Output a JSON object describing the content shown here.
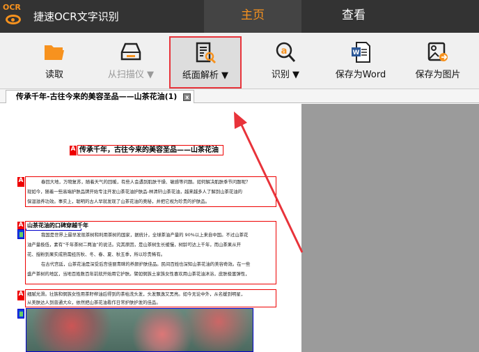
{
  "app": {
    "logo_text": "OCR",
    "title": "捷速OCR文字识别"
  },
  "tabs": [
    {
      "label": "主页",
      "active": true
    },
    {
      "label": "查看",
      "active": false
    }
  ],
  "toolbar": {
    "items": [
      {
        "label": "读取",
        "icon": "folder-icon"
      },
      {
        "label": "从扫描仪 ▼",
        "icon": "scanner-icon",
        "disabled": true
      },
      {
        "label": "纸面解析 ▼",
        "icon": "document-search-icon",
        "selected": true
      },
      {
        "label": "识别 ▼",
        "icon": "recognize-icon"
      },
      {
        "label": "保存为Word",
        "icon": "word-icon"
      },
      {
        "label": "保存为图片",
        "icon": "save-image-icon"
      }
    ]
  },
  "doc_tab": {
    "label": "传承千年-古往今来的美容圣品——山茶花油(1)",
    "close": "x"
  },
  "document": {
    "title": "传承千年，古往今来的美容圣品——山茶花油",
    "block1": [
      "春回大地，万物复苏，随着天气的回暖，有些人会遇到肌肤干燥、敏感等问题。如何解决肌肤季节问题呢？",
      "现如今，随着一些高端护肤品牌开始专注开发山茶花油护肤品-林清轩山茶花油，越来越多人了解到山茶花油的",
      "保湿滋养功效。事实上，聪明的古人早就发现了山茶花油的奥秘，并把它视为珍贵的护肤品。"
    ],
    "heading2": "山茶花油的口碑穿越千年",
    "block2": [
      "我国是世界上最早发现茶树和利用茶树的国家，据统计，全球茶油产量的 90%以上来自中国。不过山茶花",
      "油产量极低，素有“千年茶树二两油”的说法。究其原因，是山茶树生长缓慢，树龄可达上千年，而山茶果从开",
      "花、授粉到果实成熟需经历秋、冬、春、夏、秋五季，所以珍贵稀有。",
      "在古代宫廷，山茶花油是深受后宫佳丽青睐的养颜护肤佳品。民间百姓也深知山茶花油的美容奇效。在一些",
      "盛产茶树的地区，当地百姓数百年前就开始用它护肤。譬如侗族土家族女性喜欢用山茶花油沐浴，皮肤极富弹性，"
    ],
    "block3": [
      "细腻光滑。壮族和侗族女性用茶籽榨油后得到的茶枯洗头发，头发飘逸又黑亮。如今无论中外，从名媛到明星，",
      "从美肤达人到普通大众，依然把山茶花油看作日常护肤护发的佳品。"
    ]
  },
  "colors": {
    "accent": "#f7921e",
    "highlight": "#e8333a",
    "text_region": "#ee0000",
    "image_region": "#0000cc"
  }
}
